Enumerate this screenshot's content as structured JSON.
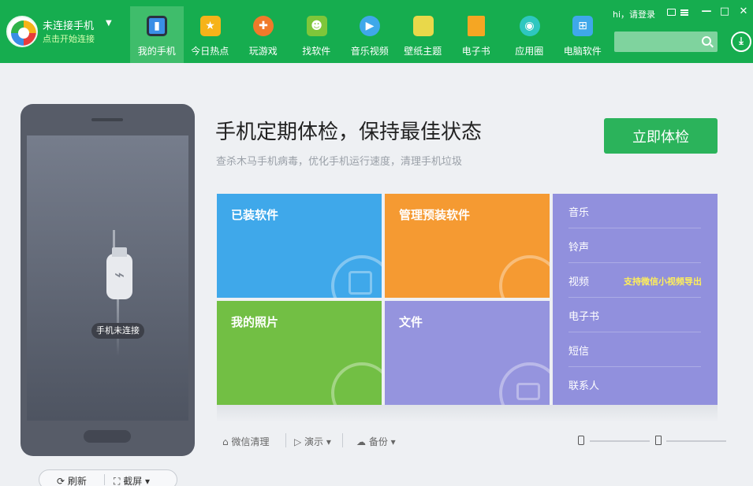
{
  "brand": {
    "title": "未连接手机",
    "subtitle": "点击开始连接",
    "caret": "▼"
  },
  "nav": [
    {
      "label": "我的手机",
      "icon": "phone-icon",
      "color": "#3a8fe6"
    },
    {
      "label": "今日热点",
      "icon": "star-icon",
      "color": "#f6b319"
    },
    {
      "label": "玩游戏",
      "icon": "gamepad-icon",
      "color": "#f07a2a"
    },
    {
      "label": "找软件",
      "icon": "android-icon",
      "color": "#7fc63a"
    },
    {
      "label": "音乐视频",
      "icon": "play-icon",
      "color": "#3fa8ea"
    },
    {
      "label": "壁纸主题",
      "icon": "wallpaper-icon",
      "color": "#e9d84a"
    },
    {
      "label": "电子书",
      "icon": "book-icon",
      "color": "#f5a623"
    },
    {
      "label": "应用圈",
      "icon": "circle-app-icon",
      "color": "#2ec7c0"
    },
    {
      "label": "电脑软件",
      "icon": "windows-icon",
      "color": "#3fa8ea"
    }
  ],
  "header": {
    "login_text": "hi，请登录",
    "search_placeholder": "",
    "minimize": "—",
    "maximize": "□",
    "close": "✕",
    "download": "⤓"
  },
  "phone": {
    "status": "手机未连接",
    "usb_symbol": "⌁",
    "refresh_label": "⟳ 刷新",
    "screenshot_label": "⛶ 截屏 ▾"
  },
  "main": {
    "headline": "手机定期体检，保持最佳状态",
    "subline": "查杀木马手机病毒，优化手机运行速度，清理手机垃圾",
    "check_button": "立即体检"
  },
  "tiles": {
    "apps": "已装软件",
    "preinstall": "管理预装软件",
    "photos": "我的照片",
    "files": "文件"
  },
  "side_list": {
    "items": [
      "音乐",
      "铃声",
      "视频",
      "电子书",
      "短信",
      "联系人"
    ],
    "video_note": "支持微信小视频导出"
  },
  "tools": {
    "wechat_clean": "微信清理",
    "demo": "演示",
    "backup": "备份"
  },
  "colors": {
    "topbar": "#16ad4f",
    "apps_tile": "#3fa8ea",
    "preinstall_tile": "#f59a32",
    "photos_tile": "#72bf44",
    "files_tile": "#9594de",
    "side_list": "#9190dd",
    "check_button": "#2bb35b"
  }
}
